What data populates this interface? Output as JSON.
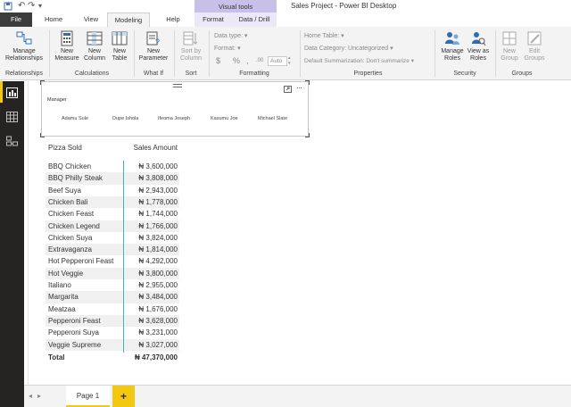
{
  "window": {
    "title": "Sales Project - Power BI Desktop",
    "contextual_group": "Visual tools"
  },
  "tabs": [
    {
      "label": "File"
    },
    {
      "label": "Home"
    },
    {
      "label": "View"
    },
    {
      "label": "Modeling"
    },
    {
      "label": "Help"
    },
    {
      "label": "Format"
    },
    {
      "label": "Data / Drill"
    }
  ],
  "ribbon": {
    "relationships": {
      "manage": "Manage Relationships",
      "group": "Relationships"
    },
    "calculations": {
      "new_measure": "New Measure",
      "new_column": "New Column",
      "new_table": "New Table",
      "group": "Calculations"
    },
    "whatif": {
      "new_parameter": "New Parameter",
      "group": "What If"
    },
    "sort": {
      "sort_by_column": "Sort by Column",
      "group": "Sort"
    },
    "formatting": {
      "data_type": "Data type:",
      "format": "Format:",
      "currency": "$",
      "percent": "%",
      "comma": ",",
      "decimals": ".00",
      "auto": "Auto",
      "group": "Formatting"
    },
    "properties": {
      "home_table": "Home Table:",
      "data_category": "Data Category: Uncategorized",
      "default_summarization": "Default Summarization: Don't summarize",
      "group": "Properties"
    },
    "security": {
      "manage_roles": "Manage Roles",
      "view_as_roles": "View as Roles",
      "group": "Security"
    },
    "groups": {
      "new_group": "New Group",
      "edit_groups": "Edit Groups",
      "group": "Groups"
    }
  },
  "slicer": {
    "title": "Manager",
    "items": [
      "Adamu Sule",
      "Dupe Ishola",
      "Ifeoma Joseph",
      "Kasumu Joe",
      "Michael Slate"
    ]
  },
  "table": {
    "headers": [
      "Pizza Sold",
      "Sales Amount"
    ],
    "rows": [
      [
        "BBQ Chicken",
        "₦ 3,600,000"
      ],
      [
        "BBQ Philly Steak",
        "₦ 3,808,000"
      ],
      [
        "Beef Suya",
        "₦ 2,943,000"
      ],
      [
        "Chicken Bali",
        "₦ 1,778,000"
      ],
      [
        "Chicken Feast",
        "₦ 1,744,000"
      ],
      [
        "Chicken Legend",
        "₦ 1,766,000"
      ],
      [
        "Chicken Suya",
        "₦ 3,824,000"
      ],
      [
        "Extravaganza",
        "₦ 1,814,000"
      ],
      [
        "Hot Pepperoni Feast",
        "₦ 4,292,000"
      ],
      [
        "Hot Veggie",
        "₦ 3,800,000"
      ],
      [
        "Italiano",
        "₦ 2,955,000"
      ],
      [
        "Margarita",
        "₦ 3,484,000"
      ],
      [
        "Meatzaa",
        "₦ 1,676,000"
      ],
      [
        "Pepperoni Feast",
        "₦ 3,628,000"
      ],
      [
        "Pepperoni Suya",
        "₦ 3,231,000"
      ],
      [
        "Veggie Supreme",
        "₦ 3,027,000"
      ]
    ],
    "total": [
      "Total",
      "₦ 47,370,000"
    ]
  },
  "pages": {
    "current": "Page 1",
    "add": "+",
    "prev": "◂",
    "next": "▸"
  },
  "colors": {
    "accent": "#f2c811",
    "visual_tools": "#c9c0ea",
    "rail": "#252423",
    "column_line": "#3fb7a9"
  }
}
